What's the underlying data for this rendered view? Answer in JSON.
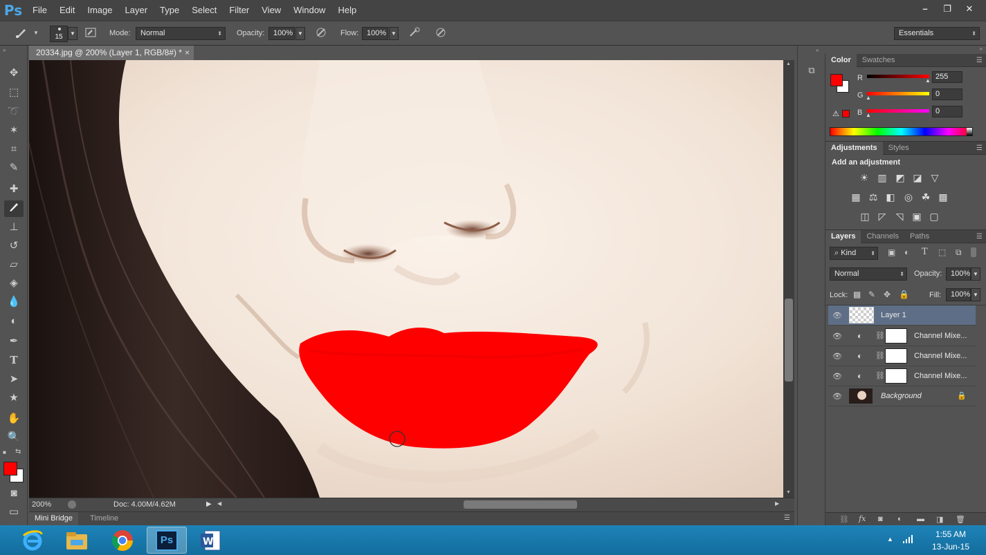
{
  "menu": {
    "logo": "Ps",
    "items": [
      "File",
      "Edit",
      "Image",
      "Layer",
      "Type",
      "Select",
      "Filter",
      "View",
      "Window",
      "Help"
    ],
    "window_controls": [
      "–",
      "❐",
      "✕"
    ]
  },
  "options": {
    "brush_size": "15",
    "mode_label": "Mode:",
    "mode_value": "Normal",
    "opacity_label": "Opacity:",
    "opacity_value": "100%",
    "flow_label": "Flow:",
    "flow_value": "100%",
    "workspace": "Essentials"
  },
  "document": {
    "tab_title": "20334.jpg @ 200% (Layer 1, RGB/8#) *",
    "tab_close": "×",
    "zoom": "200%",
    "doc_size": "Doc: 4.00M/4.62M"
  },
  "bottom_tabs": [
    "Mini Bridge",
    "Timeline"
  ],
  "color_panel": {
    "tabs": [
      "Color",
      "Swatches"
    ],
    "channels": [
      {
        "label": "R",
        "value": "255"
      },
      {
        "label": "G",
        "value": "0"
      },
      {
        "label": "B",
        "value": "0"
      }
    ],
    "foreground": "#ff0000",
    "background": "#ffffff"
  },
  "adjustments_panel": {
    "tabs": [
      "Adjustments",
      "Styles"
    ],
    "heading": "Add an adjustment"
  },
  "layers_panel": {
    "tabs": [
      "Layers",
      "Channels",
      "Paths"
    ],
    "filter_label": "Kind",
    "blend_mode": "Normal",
    "opacity_label": "Opacity:",
    "opacity_value": "100%",
    "lock_label": "Lock:",
    "fill_label": "Fill:",
    "fill_value": "100%",
    "layers": [
      {
        "name": "Layer 1",
        "selected": true
      },
      {
        "name": "Channel Mixe...",
        "selected": false
      },
      {
        "name": "Channel Mixe...",
        "selected": false
      },
      {
        "name": "Channel Mixe...",
        "selected": false
      },
      {
        "name": "Background",
        "selected": false
      }
    ]
  },
  "taskbar": {
    "time": "1:55 AM",
    "date": "13-Jun-15",
    "apps": [
      "internet-explorer",
      "file-explorer",
      "chrome",
      "photoshop",
      "word"
    ]
  },
  "colors": {
    "lipstick": "#ff0000",
    "skin": "#f1e4d8",
    "hair": "#2a1d1a",
    "selected_layer": "#5e6e86"
  }
}
